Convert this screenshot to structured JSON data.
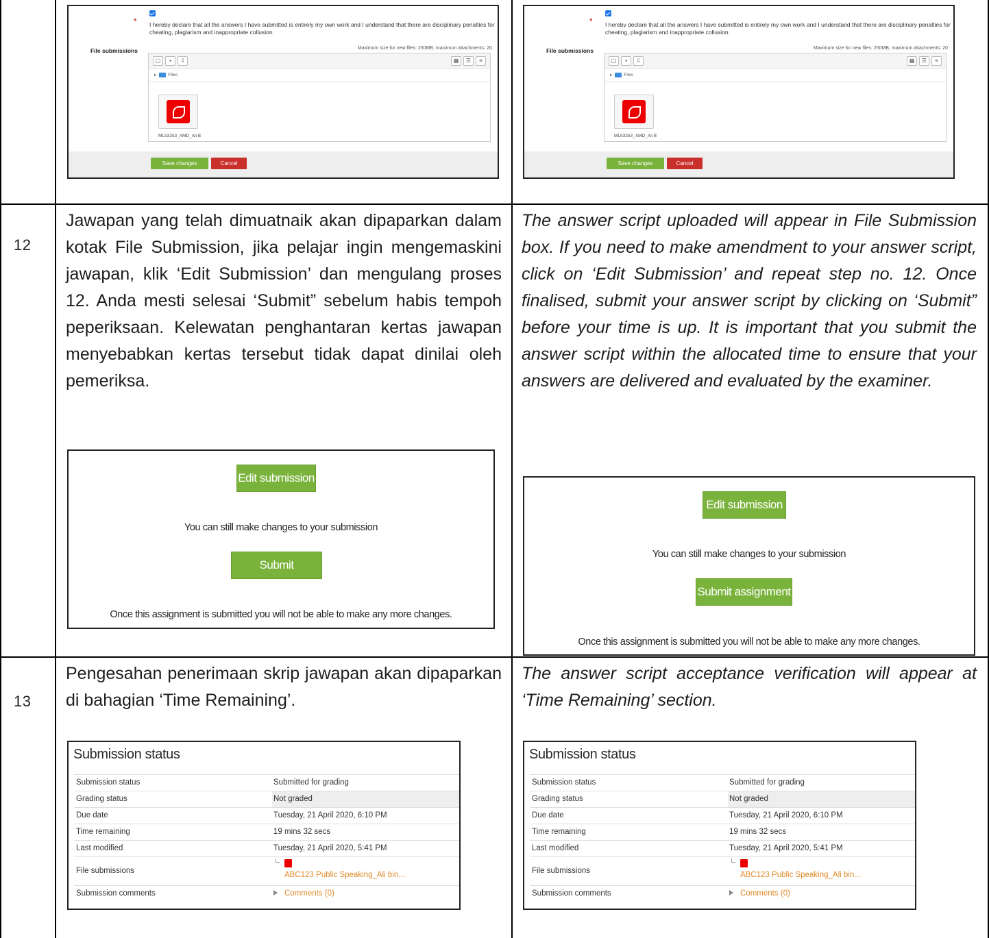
{
  "form_screenshot": {
    "declaration": "I hereby declare that all the answers I have submitted is entirely my own work and I understand that there are disciplinary penalties for cheating, plagiarism and inappropriate collusion.",
    "file_submissions_label": "File submissions",
    "max_size_note": "Maximum size for new files: 250MB, maximum attachments: 20",
    "files_path": "Files",
    "file_name": "ML53253_AMD_Ali B",
    "save_label": "Save changes",
    "cancel_label": "Cancel"
  },
  "step12": {
    "number": "12",
    "ms_text": "Jawapan yang telah dimuatnaik akan dipaparkan dalam kotak File Submission, jika pelajar ingin mengemaskini jawapan, klik ‘Edit Submission’ dan mengulang proses 12. Anda mesti selesai ‘Submit” sebelum habis tempoh peperiksaan. Kelewatan penghantaran kertas jawapan menyebabkan kertas tersebut tidak dapat dinilai oleh pemeriksa.",
    "en_text": "The answer script uploaded will appear in File Submission box. If you need to make amendment to your answer script, click on ‘Edit Submission’ and repeat step no. 12. Once finalised, submit your answer script by clicking on ‘Submit” before your time is up. It is important that you submit the answer script within the allocated time to ensure that your answers are delivered and evaluated by the examiner.",
    "edit_button": "Edit submission",
    "still_change_note": "You can still make changes to your submission",
    "submit_button": "Submit assignment",
    "final_note": "Once this assignment is submitted you will not be able to make any more changes."
  },
  "step13": {
    "number": "13",
    "ms_text": "Pengesahan penerimaan skrip jawapan akan dipaparkan di bahagian ‘Time Remaining’.",
    "en_text": "The answer script acceptance verification will appear at ‘Time Remaining’ section.",
    "status_title": "Submission status",
    "rows": [
      {
        "key": "Submission status",
        "value": "Submitted for grading"
      },
      {
        "key": "Grading status",
        "value": "Not graded"
      },
      {
        "key": "Due date",
        "value": "Tuesday, 21 April 2020, 6:10 PM"
      },
      {
        "key": "Time remaining",
        "value": "19 mins 32 secs"
      },
      {
        "key": "Last modified",
        "value": "Tuesday, 21 April 2020, 5:41 PM"
      },
      {
        "key": "File submissions",
        "value": "ABC123 Public Speaking_Ali bin..."
      },
      {
        "key": "Submission comments",
        "value": "Comments (0)"
      }
    ]
  },
  "colors": {
    "button_green": "#7ab33b",
    "button_red": "#c9302c",
    "link_orange": "#e08a28",
    "pdf_red": "#e00000"
  }
}
